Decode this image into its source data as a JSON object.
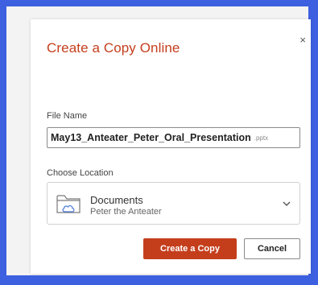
{
  "dialog": {
    "title": "Create a Copy Online",
    "close_glyph": "×",
    "file_name_label": "File Name",
    "file_name_value": "May13_Anteater_Peter_Oral_Presentation",
    "file_extension": ".pptx",
    "location_label": "Choose Location",
    "location": {
      "primary": "Documents",
      "secondary": "Peter the Anteater",
      "icon": "folder-cloud-icon"
    },
    "buttons": {
      "create_copy": "Create a Copy",
      "cancel": "Cancel"
    }
  },
  "colors": {
    "accent": "#c43e1c",
    "frame": "#3d60e0"
  }
}
